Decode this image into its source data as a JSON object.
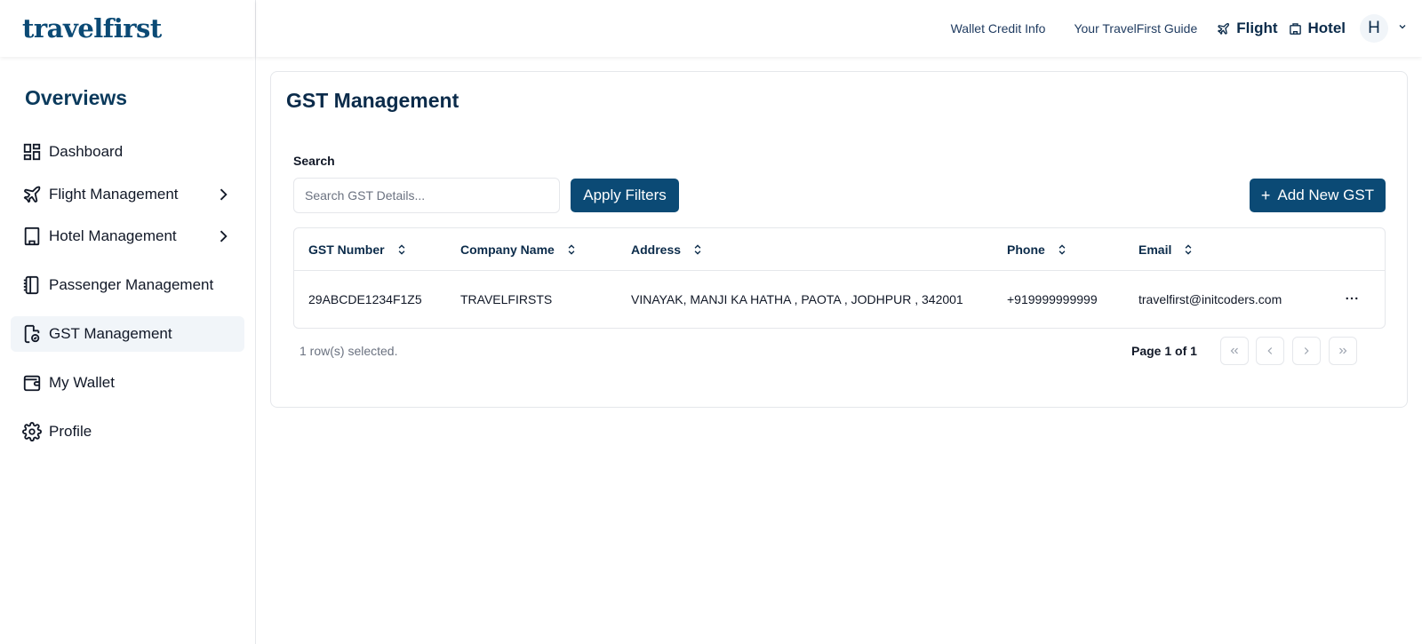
{
  "brand": {
    "logo": "travelfirst"
  },
  "sidebar": {
    "section_title": "Overviews",
    "items": [
      {
        "label": "Dashboard",
        "icon": "dashboard-grid-icon",
        "has_submenu": false
      },
      {
        "label": "Flight Management",
        "icon": "plane-icon",
        "has_submenu": true
      },
      {
        "label": "Hotel Management",
        "icon": "building-icon",
        "has_submenu": true
      },
      {
        "label": "Passenger Management",
        "icon": "notebook-icon",
        "has_submenu": false
      },
      {
        "label": "GST Management",
        "icon": "document-badge-icon",
        "has_submenu": false,
        "active": true
      },
      {
        "label": "My Wallet",
        "icon": "wallet-icon",
        "has_submenu": false
      },
      {
        "label": "Profile",
        "icon": "gear-icon",
        "has_submenu": false
      }
    ]
  },
  "header": {
    "wallet_link": "Wallet Credit Info",
    "guide_link": "Your TravelFirst Guide",
    "flight_label": "Flight",
    "hotel_label": "Hotel",
    "avatar_initial": "H"
  },
  "main": {
    "title": "GST Management",
    "search_label": "Search",
    "search_placeholder": "Search GST Details...",
    "search_value": "",
    "apply_label": "Apply Filters",
    "add_label": "Add New GST",
    "add_icon": "+",
    "table": {
      "columns": [
        "GST Number",
        "Company Name",
        "Address",
        "Phone",
        "Email"
      ],
      "rows": [
        [
          "29ABCDE1234F1Z5",
          "TRAVELFIRSTS",
          "VINAYAK, MANJI KA HATHA , PAOTA , JODHPUR , 342001",
          "+919999999999",
          "travelfirst@initcoders.com"
        ]
      ]
    },
    "selection_text": "1 row(s) selected.",
    "page_info": "Page 1 of 1"
  },
  "colors": {
    "primary": "#0b4a75",
    "heading": "#0b2b4a",
    "active_bg": "#f1f5f9",
    "border": "#e5e7eb"
  }
}
